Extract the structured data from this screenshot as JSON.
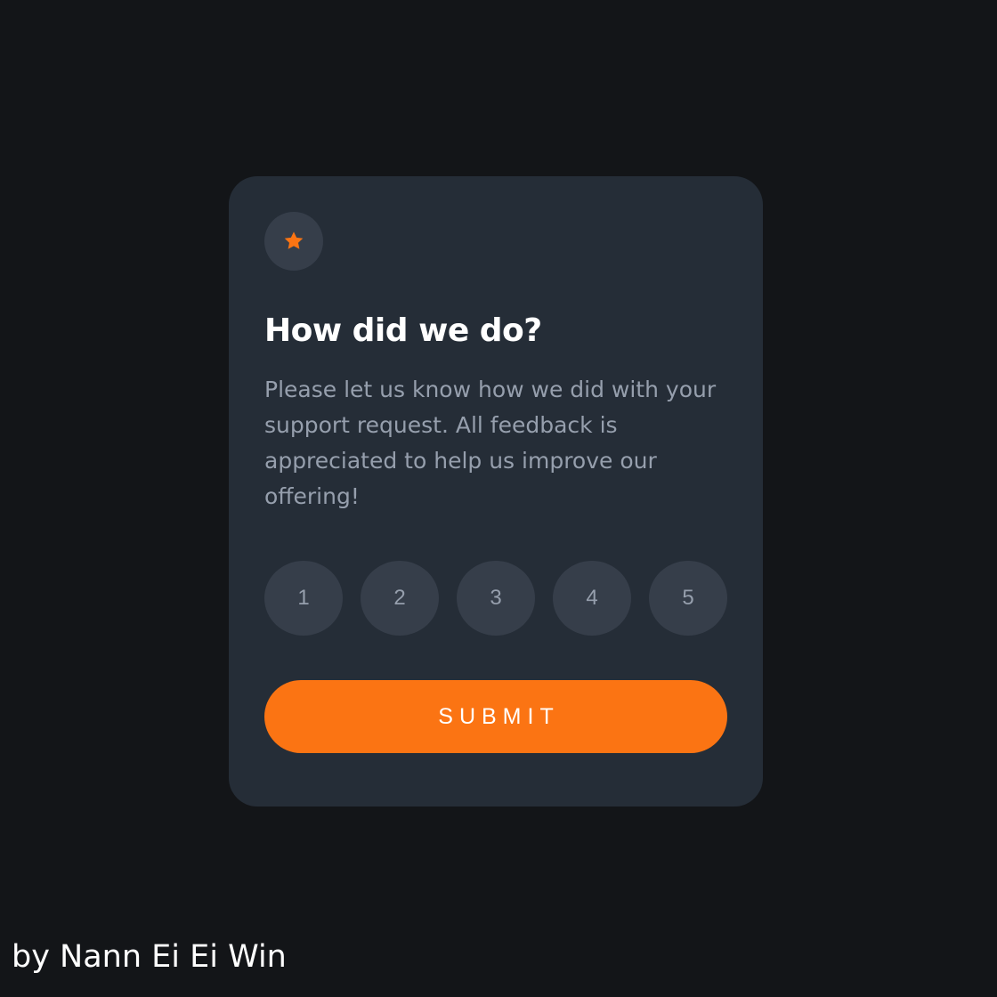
{
  "colors": {
    "page_background": "#131518",
    "card_background": "#252d37",
    "circle_background": "#363e4a",
    "accent_orange": "#fb7413",
    "muted_text": "#969fad",
    "white": "#ffffff"
  },
  "card": {
    "icon": "star-icon",
    "title": "How did we do?",
    "description": "Please let us know how we did with your support request. All feedback is appreciated to help us improve our offering!",
    "ratings": [
      "1",
      "2",
      "3",
      "4",
      "5"
    ],
    "submit_label": "SUBMIT"
  },
  "footer": {
    "attribution": "by Nann Ei Ei Win"
  }
}
